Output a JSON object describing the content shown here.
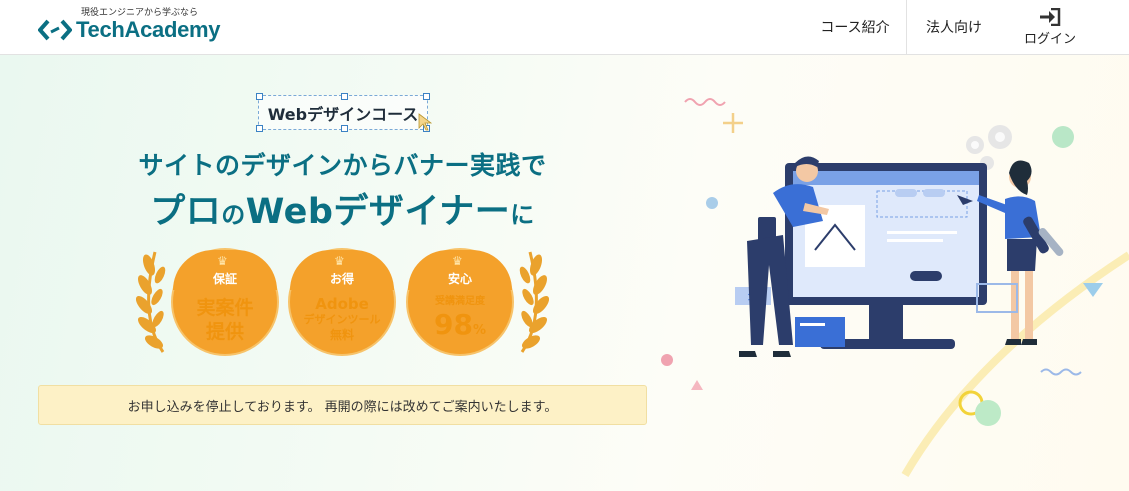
{
  "header": {
    "logo_tagline": "現役エンジニアから学ぶなら",
    "logo_text": "TechAcademy",
    "nav": {
      "courses": "コース紹介",
      "corporate": "法人向け",
      "login": "ログイン"
    }
  },
  "hero": {
    "course_tag": "Webデザインコース",
    "headline_line1": "サイトのデザインからバナー実践で",
    "headline_line2_a": "プロ",
    "headline_line2_b": "の",
    "headline_line2_c": "Webデザイナー",
    "headline_line2_d": "に",
    "badges": [
      {
        "label": "保証",
        "line1": "実案件",
        "line2": "提供"
      },
      {
        "label": "お得",
        "line1": "Adobe",
        "line2": "デザインツール",
        "line3": "無料"
      },
      {
        "label": "安心",
        "line1": "受講満足度",
        "value": "98",
        "unit": "%"
      }
    ],
    "notice": "お申し込みを停止しております。 再開の際には改めてご案内いたします。"
  },
  "colors": {
    "brand": "#0b6f83",
    "badge": "#f4a12b",
    "notice_bg": "#fdf1c6"
  },
  "icons": {
    "logo": "code-brackets-icon",
    "login": "login-arrow-icon",
    "crown": "crown-icon",
    "laurel": "laurel-icon"
  }
}
